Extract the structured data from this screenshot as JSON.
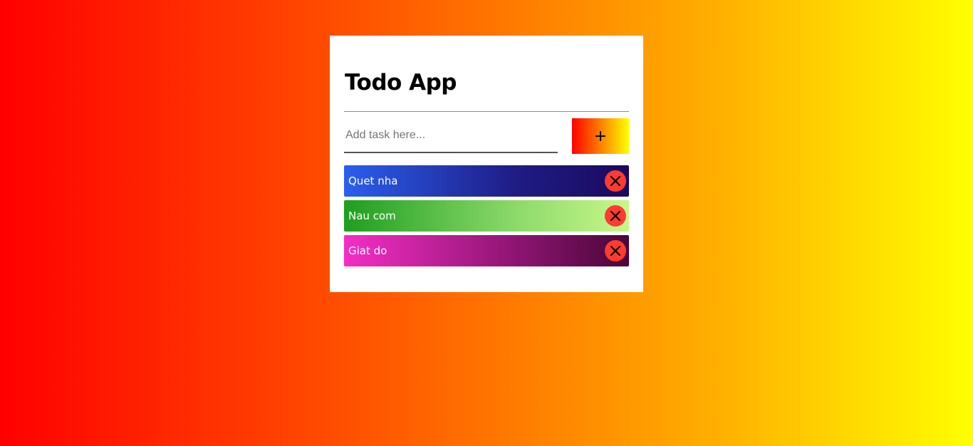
{
  "app": {
    "title": "Todo App"
  },
  "input": {
    "placeholder": "Add task here...",
    "value": ""
  },
  "add_button": {
    "label": "+"
  },
  "tasks": [
    {
      "text": "Quet nha",
      "gradient": [
        "#2a5fee",
        "#1f1c85",
        "#1a0a5e"
      ]
    },
    {
      "text": "Nau com",
      "gradient": [
        "#1f9e1f",
        "#8cd96a",
        "#c8f78a"
      ]
    },
    {
      "text": "Giat do",
      "gradient": [
        "#f52ec4",
        "#8e1572",
        "#4a0638"
      ]
    }
  ],
  "colors": {
    "background_start": "#ff0000",
    "background_end": "#ffff00",
    "delete_button": "#ff3b30",
    "card": "#ffffff"
  },
  "icons": {
    "add": "plus-icon",
    "delete": "close-icon"
  }
}
